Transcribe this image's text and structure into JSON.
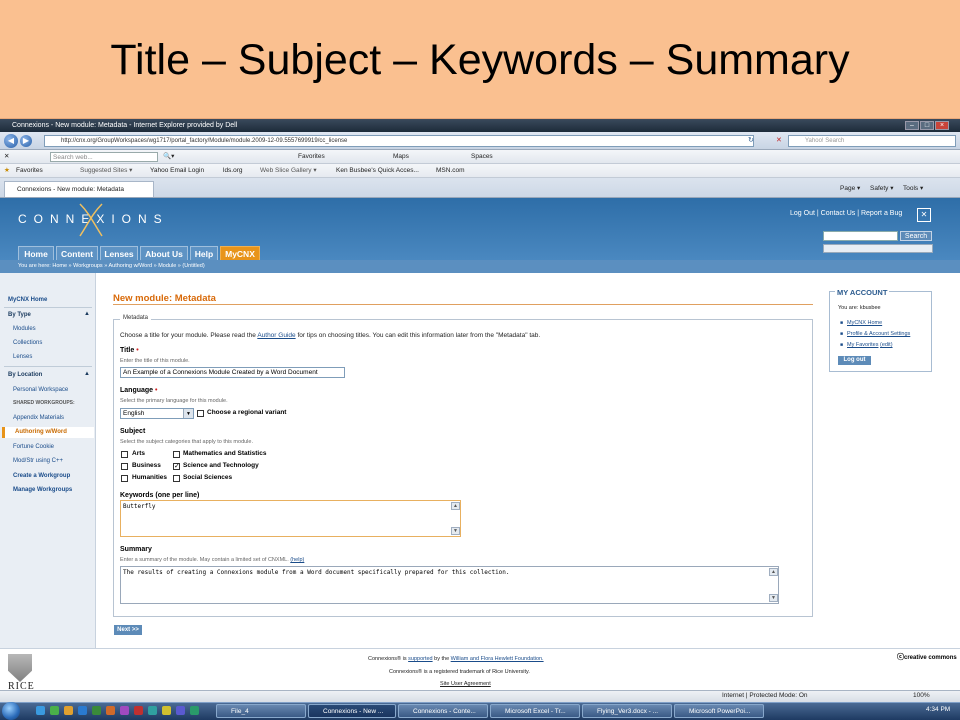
{
  "slide": {
    "title": "Title – Subject – Keywords – Summary"
  },
  "browser": {
    "window_title": "Connexions - New module: Metadata - Internet Explorer provided by Dell",
    "address": "http://cnx.org/GroupWorkspaces/wg1717/portal_factory/Module/module.2009-12-09.5557699919/cc_license",
    "yahoo_placeholder": "Yahoo! Search",
    "toolbar_search_placeholder": "Search web...",
    "toolbar_items": [
      "Favorites",
      "Maps",
      "Spaces"
    ],
    "favorites_label": "Favorites",
    "favorites_links": [
      "Suggested Sites ▾",
      "Yahoo Email Login",
      "lds.org",
      "Web Slice Gallery ▾",
      "Ken Busbee's Quick Acces...",
      "MSN.com"
    ],
    "tab_label": "Connexions - New module: Metadata",
    "command_items": [
      "Page ▾",
      "Safety ▾",
      "Tools ▾"
    ]
  },
  "site": {
    "logo": "CONNEXIONS",
    "links": [
      "Log Out",
      "Contact Us",
      "Report a Bug"
    ],
    "search_button": "Search",
    "nav_tabs": [
      "Home",
      "Content",
      "Lenses",
      "About Us",
      "Help",
      "MyCNX"
    ],
    "breadcrumb": "You are here: Home » Workgroups » Authoring w/Word » Module » (Untitled)"
  },
  "sidebar": {
    "home": "MyCNX Home",
    "by_type": "By Type",
    "type_items": [
      "Modules",
      "Collections",
      "Lenses"
    ],
    "by_location": "By Location",
    "location_items": [
      "Personal Workspace",
      "SHARED WORKGROUPS:",
      "Appendix Materials",
      "Authoring w/Word",
      "Fortune Cookie",
      "Mod/Str using C++"
    ],
    "create_workgroup": "Create a Workgroup",
    "manage_workgroups": "Manage Workgroups"
  },
  "form": {
    "page_title": "New module: Metadata",
    "legend": "Metadata",
    "intro_before": "Choose a title for your module. Please read the",
    "intro_link": "Author Guide",
    "intro_after": "for tips on choosing titles. You can edit this information later from the \"Metadata\" tab.",
    "title_label": "Title",
    "title_hint": "Enter the title of this module.",
    "title_value": "An Example of a Connexions Module Created by a Word Document",
    "language_label": "Language",
    "language_hint": "Select the primary language for this module.",
    "language_value": "English",
    "regional_label": "Choose a regional variant",
    "subject_label": "Subject",
    "subject_hint": "Select the subject categories that apply to this module.",
    "subjects": {
      "arts": "Arts",
      "math": "Mathematics and Statistics",
      "business": "Business",
      "science": "Science and Technology",
      "humanities": "Humanities",
      "social": "Social Sciences"
    },
    "checked_mark": "✓",
    "keywords_label": "Keywords (one per line)",
    "keywords_value": "Butterfly",
    "summary_label": "Summary",
    "summary_hint": "Enter a summary of the module. May contain a limited set of CNXML.",
    "summary_help": "(help)",
    "summary_value": "The results of creating a Connexions module from a Word document specifically prepared for this collection.",
    "next_button": "Next >>"
  },
  "account": {
    "title": "MY ACCOUNT",
    "user_text": "You are: kbusbee",
    "links": [
      "MyCNX Home",
      "Profile & Account Settings",
      "My Favorites"
    ],
    "edit_link": "(edit)",
    "logout": "Log out"
  },
  "footer": {
    "line1_a": "Connexions® is",
    "line1_link1": "supported",
    "line1_b": "by the",
    "line1_link2": "William and Flora Hewlett Foundation.",
    "line2": "Connexions® is a registered trademark of Rice University.",
    "line3": "Site User Agreement",
    "rice": "RICE",
    "cc": "creative commons"
  },
  "status": {
    "zone": "Internet | Protected Mode: On",
    "zoom": "100%"
  },
  "taskbar": {
    "buttons": [
      "File_4",
      "Connexions - New ...",
      "Connexions - Conte...",
      "Microsoft Excel - Tr...",
      "Flying_Ver3.docx - ...",
      "Microsoft PowerPoi..."
    ],
    "time": "4:34 PM"
  },
  "colors": {
    "slide_band": "#fac090",
    "cnx_blue": "#2e6ea8",
    "accent_orange": "#e8941a",
    "link": "#1a4c8a"
  }
}
